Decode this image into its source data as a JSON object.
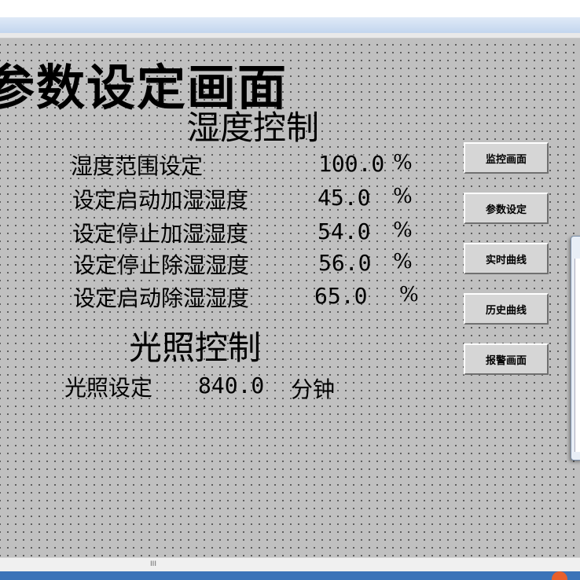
{
  "page": {
    "title": "参数设定画面",
    "humidity_heading": "湿度控制",
    "light_heading": "光照控制"
  },
  "humidity_rows": [
    {
      "label": "湿度范围设定",
      "value": "100.0",
      "unit": "%"
    },
    {
      "label": "设定启动加湿湿度",
      "value": "45.0",
      "unit": "%"
    },
    {
      "label": "设定停止加湿湿度",
      "value": "54.0",
      "unit": "%"
    },
    {
      "label": "设定停止除湿湿度",
      "value": "56.0",
      "unit": "%"
    },
    {
      "label": "设定启动除湿湿度",
      "value": "65.0",
      "unit": "%"
    }
  ],
  "light_row": {
    "label": "光照设定",
    "value": "840.0",
    "unit": "分钟"
  },
  "nav_buttons": [
    {
      "label": "监控画面"
    },
    {
      "label": "参数设定"
    },
    {
      "label": "实时曲线"
    },
    {
      "label": "历史曲线"
    },
    {
      "label": "报警画面"
    }
  ],
  "scrollbar": {
    "thumb_glyph": "III"
  },
  "colors": {
    "canvas": "#c0c0c0",
    "grid_dot": "#4a4a4a",
    "button_face": "#d6d6d6",
    "taskbar": "#3b73b8"
  }
}
